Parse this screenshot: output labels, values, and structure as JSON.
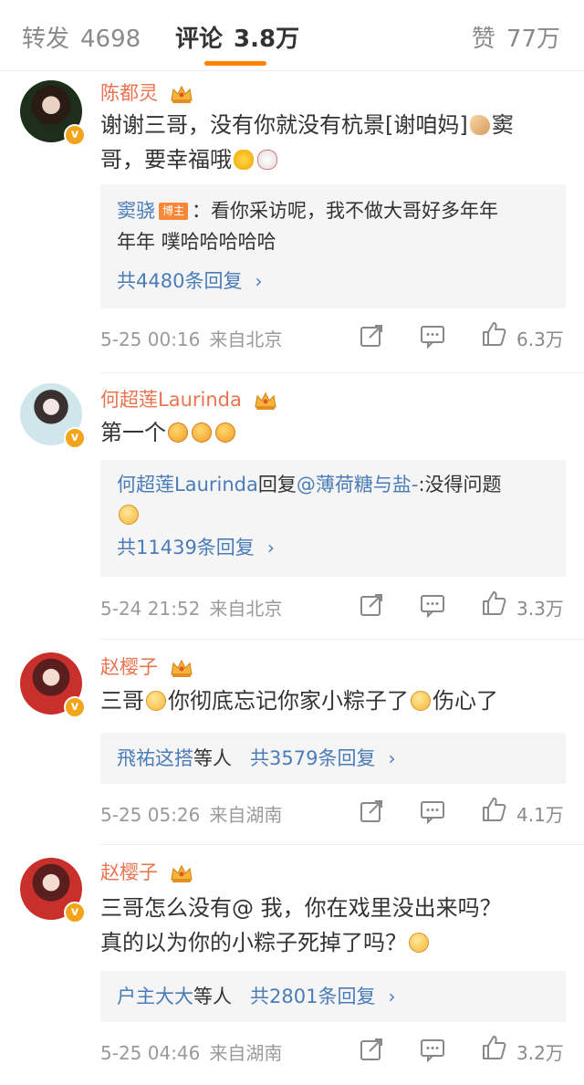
{
  "tabs": {
    "repost": {
      "label": "转发",
      "count": "4698"
    },
    "comments": {
      "label": "评论",
      "count": "3.8万"
    },
    "likes": {
      "label": "赞",
      "count": "77万"
    }
  },
  "colors": {
    "accent": "#ff8200",
    "username": "#eb7350",
    "link": "#4a7cb8",
    "meta": "#9a9a9a"
  },
  "comments": [
    {
      "author": "陈都灵",
      "text_a": "谢谢三哥，没有你就没有杭景[谢咱妈]",
      "text_b": "窦",
      "text_c": "哥，要幸福哦",
      "reply_author": "窦骁",
      "reply_badge": "博主",
      "reply_text_a": "：看你采访呢，我不做大哥好多年年",
      "reply_text_b": "年年  噗哈哈哈哈哈",
      "reply_count": "共4480条回复",
      "time": "5-25  00:16",
      "location": "来自北京",
      "likes": "6.3万"
    },
    {
      "author": "何超莲Laurinda",
      "text_a": "第一个",
      "reply_author": "何超莲Laurinda",
      "reply_verb": "回复",
      "reply_mention": "@薄荷糖与盐-",
      "reply_text_a": ":没得问题",
      "reply_count": "共11439条回复",
      "time": "5-24  21:52",
      "location": "来自北京",
      "likes": "3.3万"
    },
    {
      "author": "赵樱子",
      "text_a": "三哥",
      "text_b": "你彻底忘记你家小粽子了",
      "text_c": "伤心了",
      "reply_author": "飛祐这搭",
      "reply_suffix": "等人",
      "reply_count": "共3579条回复",
      "time": "5-25  05:26",
      "location": "来自湖南",
      "likes": "4.1万"
    },
    {
      "author": "赵樱子",
      "text_a": "三哥怎么没有@  我，你在戏里没出来吗？",
      "text_b": "真的以为你的小粽子死掉了吗？",
      "reply_author": "户主大大",
      "reply_suffix": "等人",
      "reply_count": "共2801条回复",
      "time": "5-25  04:46",
      "location": "来自湖南",
      "likes": "3.2万"
    }
  ]
}
